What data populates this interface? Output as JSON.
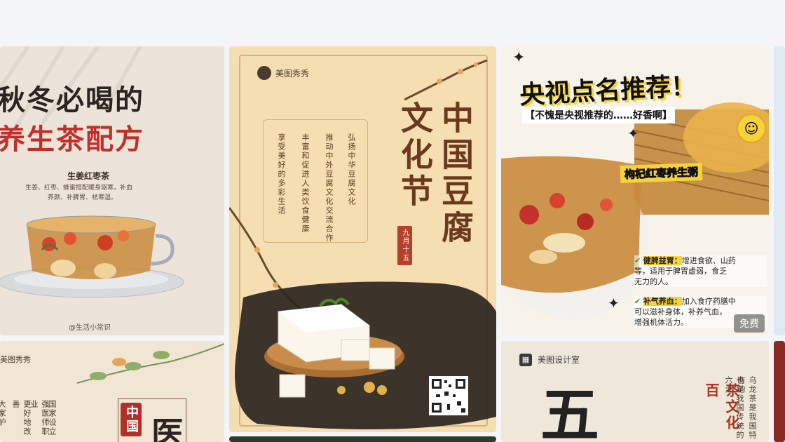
{
  "cards": {
    "tea": {
      "title_line1": "秋冬必喝的",
      "title_line2": "养生茶配方",
      "recipe_name": "生姜红枣茶",
      "recipe_desc_line1": "生姜、红枣、蜂蜜搭配暖身驱寒，补血",
      "recipe_desc_line2": "养颜、补脾胃、祛寒湿。",
      "credit": "@生活小常识"
    },
    "tofu": {
      "brand": "美图秀秀",
      "title_col1": "文化节",
      "title_col2": "中国豆腐",
      "date_seal": "九月十五",
      "text_col1": "弘扬中华豆腐文化",
      "text_col2": "推动中外豆腐文化交流合作",
      "text_col3": "丰富和促进人类饮食健康",
      "text_col4": "享受美好的多彩生活"
    },
    "porridge": {
      "title": "央视点名推荐！",
      "subtitle": "【不愧是央视推荐的……好香啊】",
      "tag": "枸杞红枣养生粥",
      "bullet1_key": "健脾益胃：",
      "bullet1_line1": "增进食欲、山药",
      "bullet1_line2": "等，适用于脾胃虚弱，食乏",
      "bullet1_line3": "无力的人。",
      "bullet2_key": "补气养血：",
      "bullet2_line1": "加入食疗药膳中",
      "bullet2_line2": "可以滋补身体，补养气血，",
      "bullet2_line3": "增强机体活力。",
      "badge": "免费"
    },
    "medicine": {
      "brand": "美图秀秀",
      "col1": "国家设立",
      "col2": "强医师职业",
      "col3": "更好地改善",
      "col4": "大家护",
      "seal": "中国",
      "big_char": "医"
    },
    "teaculture": {
      "brand": "美图设计室",
      "big_char": "五",
      "title_col": "茶文化百",
      "text_col1": "乌龙茶是我国特有的",
      "text_col2": "也是我国传统的六大"
    }
  },
  "colors": {
    "page_bg": "#f3f5f9",
    "tea_red": "#c0302a",
    "tofu_brown": "#6b3a1e",
    "porridge_yellow": "#f6d23c"
  }
}
